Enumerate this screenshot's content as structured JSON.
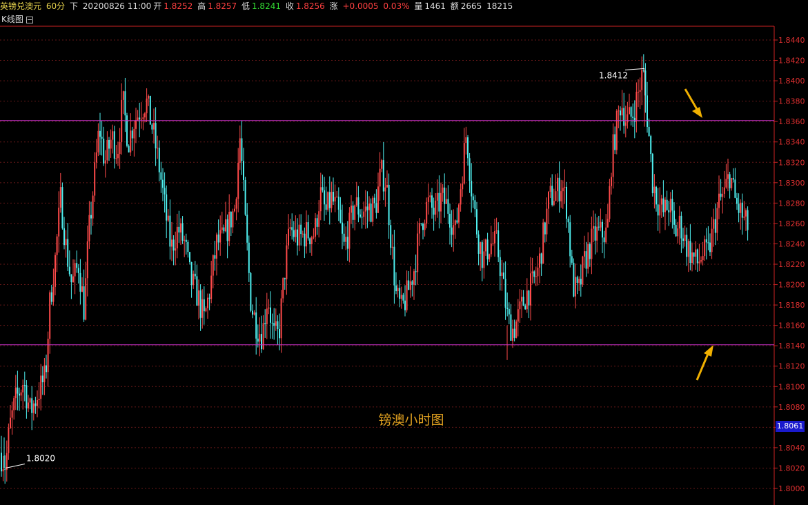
{
  "header": {
    "symbol": "英镑兑澳元",
    "period": "60分",
    "nav": "下",
    "datetime": "20200826 11:00",
    "open_label": "开",
    "open": "1.8252",
    "high_label": "高",
    "high": "1.8257",
    "low_label": "低",
    "low": "1.8241",
    "close_label": "收",
    "close": "1.8256",
    "change_label": "涨",
    "change": "+0.0005",
    "change_pct": "0.03%",
    "volume_label": "量",
    "volume": "1461",
    "amount_label": "额",
    "amount": "2665",
    "extra": "18215"
  },
  "subheader": {
    "title": "K线图"
  },
  "watermark": "镑澳小时图",
  "colors": {
    "up": "#ff4a4a",
    "down": "#4ff0f0",
    "resistance": "#cc33cc",
    "arrow": "#f0b000",
    "axis": "#cc2222"
  },
  "chart_data": {
    "type": "candlestick",
    "ylim": [
      1.799,
      1.845
    ],
    "yticks": [
      "1.8000",
      "1.8020",
      "1.8040",
      "1.8060",
      "1.8080",
      "1.8100",
      "1.8120",
      "1.8140",
      "1.8160",
      "1.8180",
      "1.8200",
      "1.8220",
      "1.8240",
      "1.8260",
      "1.8280",
      "1.8300",
      "1.8320",
      "1.8340",
      "1.8360",
      "1.8380",
      "1.8400",
      "1.8420",
      "1.8440"
    ],
    "current_price": "1.8061",
    "annotations": [
      {
        "text": "1.8412",
        "value": 1.8412
      },
      {
        "text": "1.8020",
        "value": 1.802
      }
    ],
    "horizontal_lines": [
      1.8361,
      1.8141
    ],
    "path": [
      [
        0,
        1.8035
      ],
      [
        8,
        1.8022
      ],
      [
        14,
        1.806
      ],
      [
        22,
        1.8085
      ],
      [
        34,
        1.8105
      ],
      [
        44,
        1.8075
      ],
      [
        56,
        1.8095
      ],
      [
        66,
        1.811
      ],
      [
        72,
        1.818
      ],
      [
        80,
        1.8225
      ],
      [
        88,
        1.8285
      ],
      [
        96,
        1.8235
      ],
      [
        104,
        1.82
      ],
      [
        114,
        1.822
      ],
      [
        122,
        1.8175
      ],
      [
        128,
        1.8245
      ],
      [
        136,
        1.83
      ],
      [
        144,
        1.8355
      ],
      [
        152,
        1.832
      ],
      [
        162,
        1.8345
      ],
      [
        170,
        1.833
      ],
      [
        178,
        1.838
      ],
      [
        186,
        1.834
      ],
      [
        194,
        1.836
      ],
      [
        202,
        1.837
      ],
      [
        212,
        1.838
      ],
      [
        222,
        1.835
      ],
      [
        232,
        1.831
      ],
      [
        240,
        1.827
      ],
      [
        248,
        1.8235
      ],
      [
        258,
        1.8255
      ],
      [
        268,
        1.824
      ],
      [
        276,
        1.8205
      ],
      [
        286,
        1.819
      ],
      [
        296,
        1.8165
      ],
      [
        304,
        1.8195
      ],
      [
        314,
        1.824
      ],
      [
        324,
        1.8245
      ],
      [
        332,
        1.826
      ],
      [
        340,
        1.8275
      ],
      [
        348,
        1.8345
      ],
      [
        356,
        1.8255
      ],
      [
        364,
        1.818
      ],
      [
        372,
        1.816
      ],
      [
        380,
        1.815
      ],
      [
        388,
        1.819
      ],
      [
        396,
        1.815
      ],
      [
        404,
        1.815
      ],
      [
        412,
        1.821
      ],
      [
        420,
        1.8255
      ],
      [
        432,
        1.8245
      ],
      [
        444,
        1.825
      ],
      [
        456,
        1.825
      ],
      [
        464,
        1.829
      ],
      [
        472,
        1.827
      ],
      [
        480,
        1.8285
      ],
      [
        490,
        1.827
      ],
      [
        498,
        1.8235
      ],
      [
        506,
        1.8255
      ],
      [
        514,
        1.828
      ],
      [
        524,
        1.827
      ],
      [
        534,
        1.8275
      ],
      [
        544,
        1.8275
      ],
      [
        552,
        1.831
      ],
      [
        560,
        1.83
      ],
      [
        566,
        1.825
      ],
      [
        574,
        1.819
      ],
      [
        582,
        1.8175
      ],
      [
        590,
        1.819
      ],
      [
        600,
        1.8215
      ],
      [
        610,
        1.826
      ],
      [
        620,
        1.828
      ],
      [
        630,
        1.827
      ],
      [
        640,
        1.8285
      ],
      [
        650,
        1.8275
      ],
      [
        660,
        1.825
      ],
      [
        668,
        1.83
      ],
      [
        676,
        1.835
      ],
      [
        684,
        1.829
      ],
      [
        692,
        1.825
      ],
      [
        700,
        1.8225
      ],
      [
        710,
        1.824
      ],
      [
        720,
        1.824
      ],
      [
        728,
        1.8205
      ],
      [
        736,
        1.8165
      ],
      [
        744,
        1.8155
      ],
      [
        752,
        1.817
      ],
      [
        762,
        1.819
      ],
      [
        772,
        1.82
      ],
      [
        780,
        1.8215
      ],
      [
        788,
        1.825
      ],
      [
        796,
        1.8285
      ],
      [
        806,
        1.829
      ],
      [
        814,
        1.83
      ],
      [
        822,
        1.8275
      ],
      [
        830,
        1.82
      ],
      [
        838,
        1.819
      ],
      [
        846,
        1.822
      ],
      [
        856,
        1.824
      ],
      [
        864,
        1.825
      ],
      [
        872,
        1.825
      ],
      [
        880,
        1.825
      ],
      [
        886,
        1.832
      ],
      [
        892,
        1.835
      ],
      [
        900,
        1.838
      ],
      [
        908,
        1.836
      ],
      [
        916,
        1.8365
      ],
      [
        924,
        1.8385
      ],
      [
        932,
        1.841
      ],
      [
        940,
        1.835
      ],
      [
        946,
        1.83
      ],
      [
        954,
        1.828
      ],
      [
        962,
        1.827
      ],
      [
        970,
        1.828
      ],
      [
        978,
        1.825
      ],
      [
        986,
        1.826
      ],
      [
        994,
        1.824
      ],
      [
        1002,
        1.823
      ],
      [
        1010,
        1.822
      ],
      [
        1018,
        1.823
      ],
      [
        1026,
        1.823
      ],
      [
        1034,
        1.8255
      ],
      [
        1042,
        1.828
      ],
      [
        1050,
        1.829
      ],
      [
        1058,
        1.831
      ],
      [
        1066,
        1.828
      ],
      [
        1074,
        1.827
      ],
      [
        1080,
        1.826
      ],
      [
        1086,
        1.8255
      ]
    ]
  }
}
